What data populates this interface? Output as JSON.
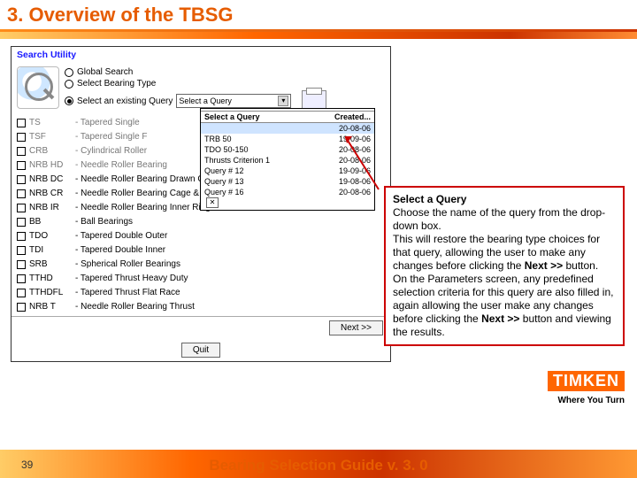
{
  "title": "3. Overview of the TBSG",
  "page_number": "39",
  "footer": "Bearing Selection Guide v. 3. 0",
  "brand": {
    "name": "TIMKEN",
    "tagline": "Where You Turn"
  },
  "search_panel": {
    "heading": "Search Utility",
    "options": {
      "global": "Global Search",
      "bearing_type": "Select Bearing Type",
      "existing_query": "Select an existing Query"
    },
    "select_placeholder": "Select a Query",
    "dropdown": {
      "input": "",
      "head_left": "Select a Query",
      "head_right": "Created...",
      "items": [
        {
          "q": "",
          "d": "20-08-06"
        },
        {
          "q": "TRB 50",
          "d": "19-09-06"
        },
        {
          "q": "TDO 50-150",
          "d": "20-08-06"
        },
        {
          "q": "Thrusts Criterion 1",
          "d": "20-08-06"
        },
        {
          "q": "Query # 12",
          "d": "19-09-06"
        },
        {
          "q": "Query # 13",
          "d": "19-08-06"
        },
        {
          "q": "Query # 16",
          "d": "20-08-06"
        }
      ]
    },
    "types": [
      {
        "c": "TS",
        "n": "- Tapered Single"
      },
      {
        "c": "TSF",
        "n": "- Tapered Single F"
      },
      {
        "c": "CRB",
        "n": "- Cylindrical Roller"
      },
      {
        "c": "NRB HD",
        "n": "- Needle Roller Bearing"
      },
      {
        "c": "NRB DC",
        "n": "- Needle Roller Bearing Drawn Cup"
      },
      {
        "c": "NRB CR",
        "n": "- Needle Roller Bearing Cage & Rollers"
      },
      {
        "c": "NRB IR",
        "n": "- Needle Roller Bearing Inner Rings"
      },
      {
        "c": "BB",
        "n": "- Ball Bearings"
      },
      {
        "c": "TDO",
        "n": "- Tapered Double Outer"
      },
      {
        "c": "TDI",
        "n": "- Tapered Double Inner"
      },
      {
        "c": "SRB",
        "n": "- Spherical Roller Bearings"
      },
      {
        "c": "TTHD",
        "n": "- Tapered Thrust Heavy Duty"
      },
      {
        "c": "TTHDFL",
        "n": "- Tapered Thrust Flat Race"
      },
      {
        "c": "NRB T",
        "n": "- Needle Roller Bearing Thrust"
      }
    ],
    "buttons": {
      "next": "Next >>",
      "quit": "Quit"
    }
  },
  "callout": {
    "heading": "Select a Query",
    "lines": [
      "Choose the name of the query from the drop-down box.",
      "This will restore the bearing type choices for that query, allowing the user to make any changes before clicking the ",
      " button.",
      "On the Parameters screen, any predefined selection criteria for this query are also filled in, again allowing the user make any changes before clicking the ",
      " button and viewing the results."
    ],
    "next_label": "Next >>"
  }
}
